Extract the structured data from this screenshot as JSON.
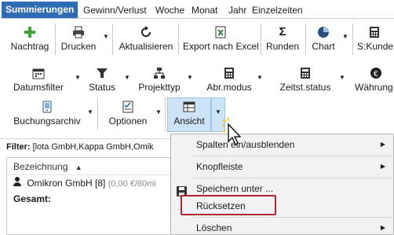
{
  "tabs": [
    {
      "label": "Summierungen",
      "active": true
    },
    {
      "label": "Gewinn/Verlust"
    },
    {
      "label": "Woche"
    },
    {
      "label": "Monat"
    },
    {
      "label": "Jahr"
    },
    {
      "label": "Einzelzeiten"
    }
  ],
  "toolbar_row1": {
    "nachtrag": "Nachtrag",
    "drucken": "Drucken",
    "aktualisieren": "Aktualisieren",
    "export": "Export nach Excel",
    "runden": "Runden",
    "chart": "Chart",
    "skunde": "S:Kunde"
  },
  "toolbar_row2": {
    "datumsfilter": "Datumsfilter",
    "status": "Status",
    "projekttyp": "Projekttyp",
    "abrmodus": "Abr.modus",
    "zeitststatus": "Zeitst.status",
    "waehrung": "Währung"
  },
  "toolbar_row3": {
    "buchungsarchiv": "Buchungsarchiv",
    "optionen": "Optionen",
    "ansicht": "Ansicht"
  },
  "filter": {
    "label": "Filter:",
    "value": "[lota GmbH,Kappa GmbH,Omik"
  },
  "grid": {
    "header": "Bezeichnung",
    "row_name": "Omikron GmbH [8]",
    "row_detail": "(0,00 €/60mi",
    "total": "Gesamt:"
  },
  "menu": {
    "items": [
      {
        "label": "Spalten ein/ausblenden",
        "submenu": true
      },
      {
        "label": "Knopfleiste",
        "submenu": true
      },
      {
        "label": "Speichern unter ...",
        "submenu": false
      },
      {
        "label": "Rücksetzen",
        "submenu": false,
        "highlighted_box": true
      },
      {
        "label": "Löschen",
        "submenu": true
      }
    ]
  },
  "colors": {
    "active_tab": "#2e6db4",
    "highlight_box": "#b0282f",
    "nachtrag_plus": "#3fa535"
  }
}
